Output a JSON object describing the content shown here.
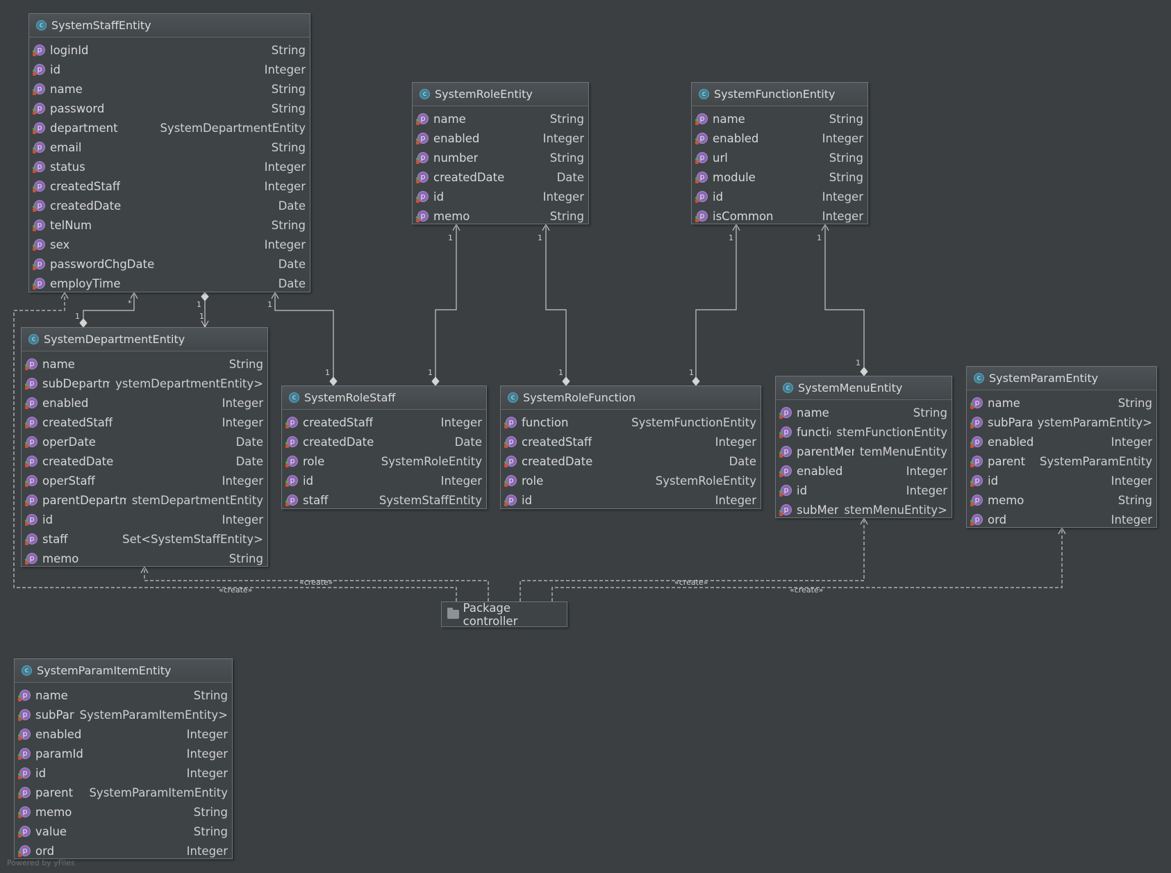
{
  "classes": {
    "staff": {
      "name": "SystemStaffEntity",
      "fields": [
        {
          "name": "loginId",
          "type": "String"
        },
        {
          "name": "id",
          "type": "Integer"
        },
        {
          "name": "name",
          "type": "String"
        },
        {
          "name": "password",
          "type": "String"
        },
        {
          "name": "department",
          "type": "SystemDepartmentEntity"
        },
        {
          "name": "email",
          "type": "String"
        },
        {
          "name": "status",
          "type": "Integer"
        },
        {
          "name": "createdStaff",
          "type": "Integer"
        },
        {
          "name": "createdDate",
          "type": "Date"
        },
        {
          "name": "telNum",
          "type": "String"
        },
        {
          "name": "sex",
          "type": "Integer"
        },
        {
          "name": "passwordChgDate",
          "type": "Date"
        },
        {
          "name": "employTime",
          "type": "Date"
        }
      ]
    },
    "role": {
      "name": "SystemRoleEntity",
      "fields": [
        {
          "name": "name",
          "type": "String"
        },
        {
          "name": "enabled",
          "type": "Integer"
        },
        {
          "name": "number",
          "type": "String"
        },
        {
          "name": "createdDate",
          "type": "Date"
        },
        {
          "name": "id",
          "type": "Integer"
        },
        {
          "name": "memo",
          "type": "String"
        }
      ]
    },
    "function": {
      "name": "SystemFunctionEntity",
      "fields": [
        {
          "name": "name",
          "type": "String"
        },
        {
          "name": "enabled",
          "type": "Integer"
        },
        {
          "name": "url",
          "type": "String"
        },
        {
          "name": "module",
          "type": "String"
        },
        {
          "name": "id",
          "type": "Integer"
        },
        {
          "name": "isCommon",
          "type": "Integer"
        }
      ]
    },
    "department": {
      "name": "SystemDepartmentEntity",
      "fields": [
        {
          "name": "name",
          "type": "String"
        },
        {
          "name": "subDepartment",
          "type": "ystemDepartmentEntity>"
        },
        {
          "name": "enabled",
          "type": "Integer"
        },
        {
          "name": "createdStaff",
          "type": "Integer"
        },
        {
          "name": "operDate",
          "type": "Date"
        },
        {
          "name": "createdDate",
          "type": "Date"
        },
        {
          "name": "operStaff",
          "type": "Integer"
        },
        {
          "name": "parentDepartment",
          "type": "stemDepartmentEntity"
        },
        {
          "name": "id",
          "type": "Integer"
        },
        {
          "name": "staff",
          "type": "Set<SystemStaffEntity>"
        },
        {
          "name": "memo",
          "type": "String"
        }
      ]
    },
    "roleStaff": {
      "name": "SystemRoleStaff",
      "fields": [
        {
          "name": "createdStaff",
          "type": "Integer"
        },
        {
          "name": "createdDate",
          "type": "Date"
        },
        {
          "name": "role",
          "type": "SystemRoleEntity"
        },
        {
          "name": "id",
          "type": "Integer"
        },
        {
          "name": "staff",
          "type": "SystemStaffEntity"
        }
      ]
    },
    "roleFunction": {
      "name": "SystemRoleFunction",
      "fields": [
        {
          "name": "function",
          "type": "SystemFunctionEntity"
        },
        {
          "name": "createdStaff",
          "type": "Integer"
        },
        {
          "name": "createdDate",
          "type": "Date"
        },
        {
          "name": "role",
          "type": "SystemRoleEntity"
        },
        {
          "name": "id",
          "type": "Integer"
        }
      ]
    },
    "menu": {
      "name": "SystemMenuEntity",
      "fields": [
        {
          "name": "name",
          "type": "String"
        },
        {
          "name": "function",
          "type": "stemFunctionEntity"
        },
        {
          "name": "parentMenu",
          "type": "temMenuEntity"
        },
        {
          "name": "enabled",
          "type": "Integer"
        },
        {
          "name": "id",
          "type": "Integer"
        },
        {
          "name": "subMenus",
          "type": "stemMenuEntity>"
        }
      ]
    },
    "param": {
      "name": "SystemParamEntity",
      "fields": [
        {
          "name": "name",
          "type": "String"
        },
        {
          "name": "subParams",
          "type": "ystemParamEntity>"
        },
        {
          "name": "enabled",
          "type": "Integer"
        },
        {
          "name": "parent",
          "type": "SystemParamEntity"
        },
        {
          "name": "id",
          "type": "Integer"
        },
        {
          "name": "memo",
          "type": "String"
        },
        {
          "name": "ord",
          "type": "Integer"
        }
      ]
    },
    "paramItem": {
      "name": "SystemParamItemEntity",
      "fields": [
        {
          "name": "name",
          "type": "String"
        },
        {
          "name": "subParams",
          "type": "SystemParamItemEntity>"
        },
        {
          "name": "enabled",
          "type": "Integer"
        },
        {
          "name": "paramId",
          "type": "Integer"
        },
        {
          "name": "id",
          "type": "Integer"
        },
        {
          "name": "parent",
          "type": "SystemParamItemEntity"
        },
        {
          "name": "memo",
          "type": "String"
        },
        {
          "name": "value",
          "type": "String"
        },
        {
          "name": "ord",
          "type": "Integer"
        }
      ]
    }
  },
  "package": {
    "label": "Package controller"
  },
  "edge_labels": {
    "create": "«create»"
  },
  "multiplicity": {
    "one": "1",
    "many": "*"
  },
  "footer": "Powered by yFiles",
  "icon_letters": {
    "class": "c",
    "property": "p"
  },
  "colors": {
    "background": "#3b3f42",
    "class_icon": "#3f7f95",
    "property_icon": "#8b67b0",
    "edge": "#c8c8c8"
  }
}
